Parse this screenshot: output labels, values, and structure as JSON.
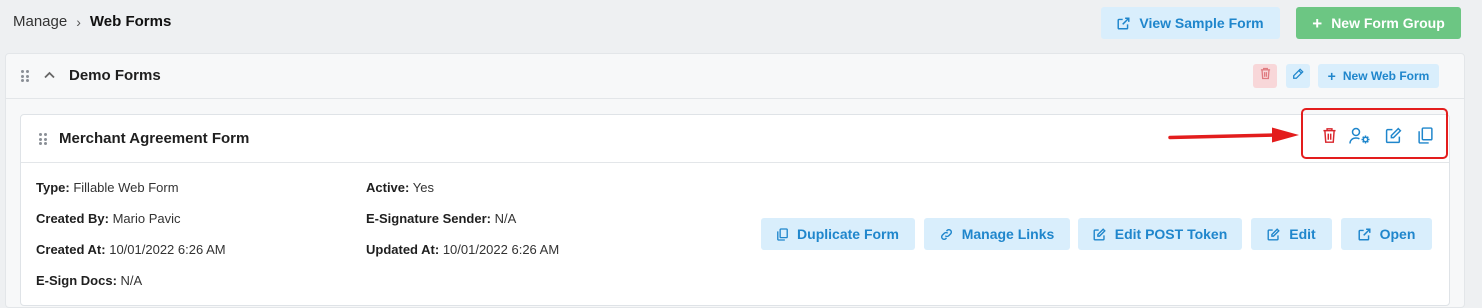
{
  "breadcrumb": {
    "root": "Manage",
    "separator": "›",
    "current": "Web Forms"
  },
  "header": {
    "view_sample_label": "View Sample Form",
    "new_group_label": "New Form Group"
  },
  "group": {
    "title": "Demo Forms",
    "new_web_form_label": "New Web Form"
  },
  "form": {
    "title": "Merchant Agreement Form",
    "fields": {
      "type_label": "Type:",
      "type_value": "Fillable Web Form",
      "created_by_label": "Created By:",
      "created_by_value": "Mario Pavic",
      "created_at_label": "Created At:",
      "created_at_value": "10/01/2022 6:26 AM",
      "esign_docs_label": "E-Sign Docs:",
      "esign_docs_value": "N/A",
      "active_label": "Active:",
      "active_value": "Yes",
      "esig_sender_label": "E-Signature Sender:",
      "esig_sender_value": "N/A",
      "updated_at_label": "Updated At:",
      "updated_at_value": "10/01/2022 6:26 AM"
    },
    "actions": {
      "duplicate": "Duplicate Form",
      "manage_links": "Manage Links",
      "edit_post_token": "Edit POST Token",
      "edit": "Edit",
      "open": "Open"
    }
  },
  "colors": {
    "accent": "#1f86cc",
    "accent_bg": "#d9eefc",
    "green": "#6cc683",
    "danger": "#d9262c",
    "annotation": "#e31d1d"
  }
}
